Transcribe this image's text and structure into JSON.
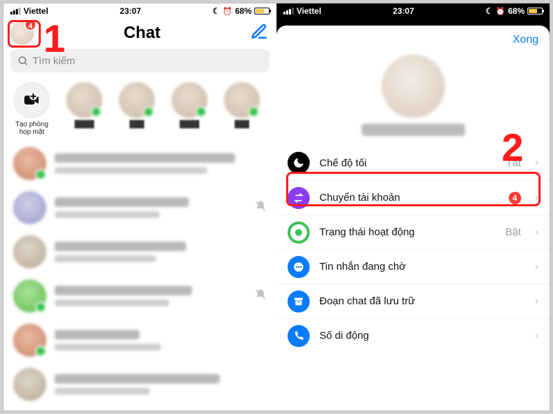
{
  "status": {
    "carrier": "Viettel",
    "time": "23:07",
    "battery_pct": "68%"
  },
  "left": {
    "avatar_badge": "4",
    "title": "Chat",
    "search_placeholder": "Tìm kiếm",
    "create_room_label": "Tạo phòng họp mặt"
  },
  "right": {
    "done_label": "Xong",
    "rows": {
      "dark_mode": {
        "label": "Chế độ tối",
        "value": "Tắt"
      },
      "switch_acc": {
        "label": "Chuyển tài khoản",
        "badge": "4"
      },
      "active": {
        "label": "Trạng thái hoạt động",
        "value": "Bật"
      },
      "pending": {
        "label": "Tin nhắn đang chờ"
      },
      "archived": {
        "label": "Đoạn chat đã lưu trữ"
      },
      "mobile": {
        "label": "Số di động"
      }
    }
  },
  "annotations": {
    "num1": "1",
    "num2": "2"
  }
}
